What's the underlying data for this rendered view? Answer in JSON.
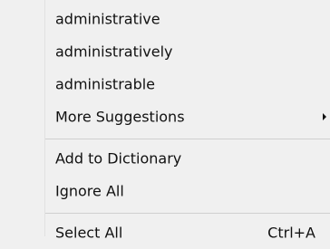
{
  "context_menu": {
    "suggestions": [
      {
        "label": "administrative"
      },
      {
        "label": "administratively"
      },
      {
        "label": "administrable"
      }
    ],
    "more_suggestions": {
      "label": "More Suggestions",
      "submenu_icon": "triangle-right-icon"
    },
    "dictionary_actions": [
      {
        "label": "Add to Dictionary"
      },
      {
        "label": "Ignore All"
      }
    ],
    "edit_actions": [
      {
        "label": "Select All",
        "shortcut": "Ctrl+A"
      }
    ]
  }
}
